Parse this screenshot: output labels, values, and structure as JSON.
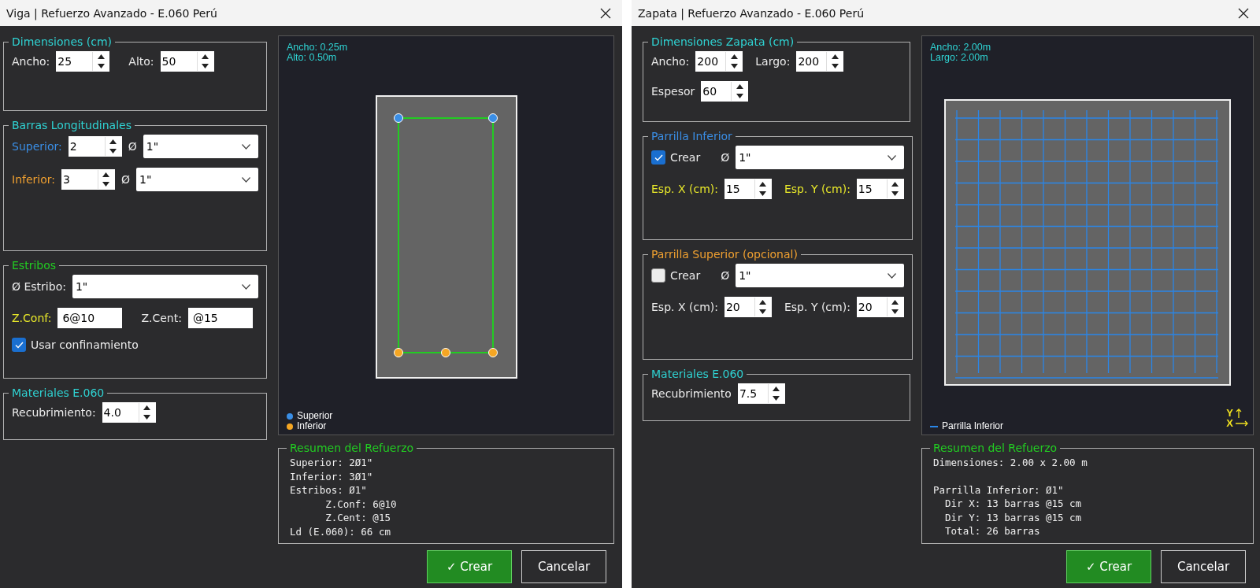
{
  "windows": [
    {
      "kind": "viga",
      "title": "Viga | Refuerzo Avanzado - E.060 Perú",
      "groups": [
        {
          "title": "Dimensiones (cm)",
          "color": "#2fd3d3",
          "rows": [
            [
              {
                "kind": "label",
                "text": "Ancho:"
              },
              {
                "kind": "spin",
                "value": "25"
              },
              {
                "kind": "label",
                "text": "Alto:"
              },
              {
                "kind": "spin",
                "value": "50"
              }
            ]
          ]
        },
        {
          "title": "Barras Longitudinales",
          "color": "#2fd3d3",
          "rows": [
            [
              {
                "kind": "label",
                "text": "Superior:",
                "color": "#3a8ee6"
              },
              {
                "kind": "spin",
                "value": "2"
              },
              {
                "kind": "label",
                "text": "Ø"
              },
              {
                "kind": "combo",
                "value": "1\""
              }
            ],
            [
              {
                "kind": "label",
                "text": "Inferior:",
                "color": "#f0a030"
              },
              {
                "kind": "spin",
                "value": "3"
              },
              {
                "kind": "label",
                "text": "Ø"
              },
              {
                "kind": "combo",
                "value": "1\""
              }
            ]
          ]
        },
        {
          "title": "Estribos",
          "color": "#22cc22",
          "rows": [
            [
              {
                "kind": "label",
                "text": "Ø Estribo:"
              },
              {
                "kind": "combo",
                "value": "1\""
              }
            ],
            [
              {
                "kind": "label",
                "text": "Z.Conf:",
                "color": "#e8e82a"
              },
              {
                "kind": "text",
                "value": "6@10"
              },
              {
                "kind": "label",
                "text": "Z.Cent:"
              },
              {
                "kind": "text",
                "value": "@15"
              }
            ],
            [
              {
                "kind": "checkbox",
                "label": "Usar confinamiento",
                "checked": true
              }
            ]
          ]
        },
        {
          "title": "Materiales E.060",
          "color": "#2fd3d3",
          "rows": [
            [
              {
                "kind": "label",
                "text": "Recubrimiento:"
              },
              {
                "kind": "spin",
                "value": "4.0"
              }
            ]
          ]
        }
      ],
      "preview": {
        "info": [
          "Ancho: 0.25m",
          "Alto: 0.50m"
        ],
        "legend": [
          {
            "label": "Superior",
            "color": "#3a8ee6"
          },
          {
            "label": "Inferior",
            "color": "#f5a623"
          }
        ]
      },
      "summary": {
        "title": "Resumen del Refuerzo",
        "blocks": [
          [
            "Superior: 2Ø1\"",
            "Inferior: 3Ø1\"",
            "Estribos: Ø1\"",
            "      Z.Conf: 6@10",
            "      Z.Cent: @15",
            "Ld (E.060): 66 cm"
          ]
        ]
      },
      "buttons": [
        {
          "kind": "primary",
          "label": "✓ Crear"
        },
        {
          "kind": "secondary",
          "label": "Cancelar"
        }
      ]
    },
    {
      "kind": "zapata",
      "title": "Zapata | Refuerzo Avanzado - E.060 Perú",
      "groups": [
        {
          "title": "Dimensiones Zapata (cm)",
          "color": "#2fd3d3",
          "rows": [
            [
              {
                "kind": "label",
                "text": "Ancho:"
              },
              {
                "kind": "spin",
                "value": "200"
              },
              {
                "kind": "label",
                "text": "Largo:"
              },
              {
                "kind": "spin",
                "value": "200"
              }
            ],
            [
              {
                "kind": "label",
                "text": "Espesor"
              },
              {
                "kind": "spin",
                "value": "60"
              }
            ]
          ]
        },
        {
          "title": "Parrilla Inferior",
          "color": "#3a8ee6",
          "rows": [
            [
              {
                "kind": "checkbox",
                "label": "Crear",
                "checked": true
              },
              {
                "kind": "label",
                "text": "Ø"
              },
              {
                "kind": "combo",
                "value": "1\""
              }
            ],
            [
              {
                "kind": "label",
                "text": "Esp. X (cm):",
                "color": "#e8e82a"
              },
              {
                "kind": "spin",
                "value": "15"
              },
              {
                "kind": "label",
                "text": "Esp. Y (cm):",
                "color": "#e8e82a"
              },
              {
                "kind": "spin",
                "value": "15"
              }
            ]
          ]
        },
        {
          "title": "Parrilla Superior (opcional)",
          "color": "#f0a030",
          "rows": [
            [
              {
                "kind": "checkbox",
                "label": "Crear",
                "checked": false
              },
              {
                "kind": "label",
                "text": "Ø"
              },
              {
                "kind": "combo",
                "value": "1\""
              }
            ],
            [
              {
                "kind": "label",
                "text": "Esp. X (cm):"
              },
              {
                "kind": "spin",
                "value": "20"
              },
              {
                "kind": "label",
                "text": "Esp. Y (cm):"
              },
              {
                "kind": "spin",
                "value": "20"
              }
            ]
          ]
        },
        {
          "title": "Materiales E.060",
          "color": "#2fd3d3",
          "rows": [
            [
              {
                "kind": "label",
                "text": "Recubrimiento"
              },
              {
                "kind": "spin",
                "value": "7.5"
              }
            ]
          ]
        }
      ],
      "preview": {
        "info": [
          "Ancho: 2.00m",
          "Largo: 2.00m"
        ],
        "legend": [
          {
            "label": "Parrilla Inferior",
            "color": "#2a86e8"
          }
        ],
        "axes": {
          "y": "Y",
          "x": "X"
        }
      },
      "summary": {
        "title": "Resumen del Refuerzo",
        "blocks": [
          [
            "Dimensiones: 2.00 x 2.00 m"
          ],
          [
            "Parrilla Inferior: Ø1\"",
            "  Dir X: 13 barras @15 cm",
            "  Dir Y: 13 barras @15 cm",
            "  Total: 26 barras"
          ]
        ]
      },
      "buttons": [
        {
          "kind": "primary",
          "label": "✓ Crear"
        },
        {
          "kind": "secondary",
          "label": "Cancelar"
        }
      ]
    }
  ]
}
